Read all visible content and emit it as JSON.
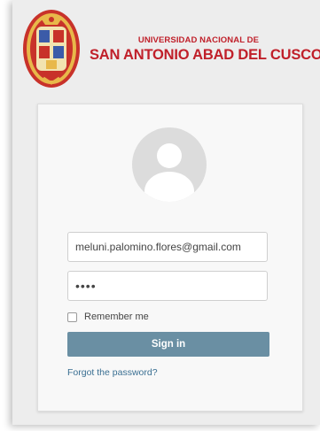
{
  "brand": {
    "university_line1": "UNIVERSIDAD NACIONAL DE",
    "university_line2": "SAN ANTONIO ABAD DEL CUSCO",
    "seal_icon": "university-seal-icon",
    "accent_color": "#c0202a"
  },
  "login": {
    "avatar_icon": "user-avatar-icon",
    "email_value": "meluni.palomino.flores@gmail.com",
    "password_value": "••••",
    "remember_label": "Remember me",
    "remember_checked": false,
    "signin_label": "Sign in",
    "signin_color": "#6a8fa3",
    "forgot_label": "Forgot the password?"
  }
}
